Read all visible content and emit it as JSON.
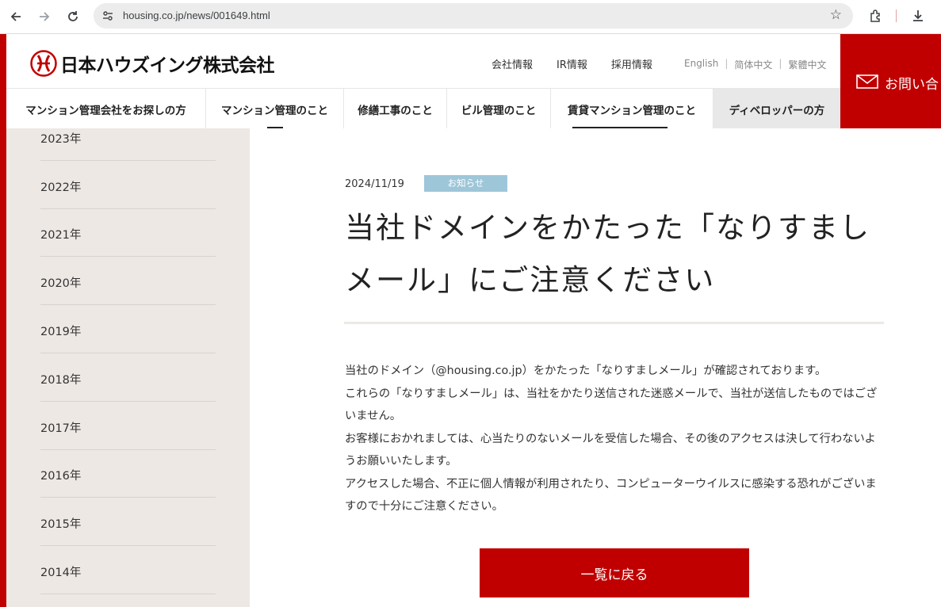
{
  "browser": {
    "url": "housing.co.jp/news/001649.html"
  },
  "header": {
    "logo_text": "日本ハウズイング株式会社",
    "top_links": [
      "会社情報",
      "IR情報",
      "採用情報"
    ],
    "languages": [
      "English",
      "简体中文",
      "繁體中文"
    ],
    "contact_label": "お問い合"
  },
  "nav": {
    "items": [
      "マンション管理会社をお探しの方",
      "マンション管理のこと",
      "修繕工事のこと",
      "ビル管理のこと",
      "賃貸マンション管理のこと",
      "ディベロッパーの方"
    ]
  },
  "sidebar": {
    "years": [
      "2023年",
      "2022年",
      "2021年",
      "2020年",
      "2019年",
      "2018年",
      "2017年",
      "2016年",
      "2015年",
      "2014年"
    ]
  },
  "article": {
    "date": "2024/11/19",
    "category": "お知らせ",
    "title_line1": "当社ドメインをかたった「なりすまし",
    "title_line2": "メール」にご注意ください",
    "paragraphs": [
      "当社のドメイン（@housing.co.jp）をかたった「なりすましメール」が確認されております。",
      "これらの「なりすましメール」は、当社をかたり送信された迷惑メールで、当社が送信したものではございません。",
      "お客様におかれましては、心当たりのないメールを受信した場合、その後のアクセスは決して行わないようお願いいたします。",
      "アクセスした場合、不正に個人情報が利用されたり、コンピューターウイルスに感染する恐れがございますので十分にご注意ください。"
    ],
    "back_button": "一覧に戻る"
  },
  "colors": {
    "brand_red": "#c00000",
    "badge_blue": "#9ec6d9",
    "sidebar_bg": "#ede8e4"
  }
}
